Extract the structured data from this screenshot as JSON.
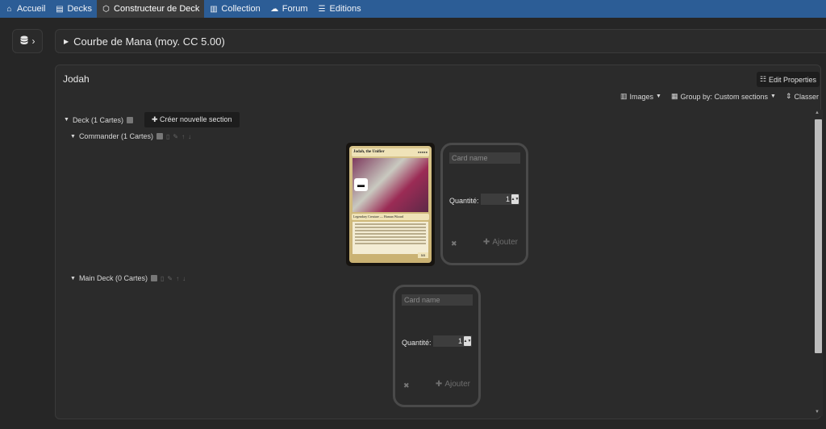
{
  "nav": {
    "items": [
      {
        "label": "Accueil",
        "icon": "home-icon",
        "glyph": "⌂"
      },
      {
        "label": "Decks",
        "icon": "decks-icon",
        "glyph": "▤"
      },
      {
        "label": "Constructeur de Deck",
        "icon": "deck-builder-icon",
        "glyph": "⬡",
        "active": true
      },
      {
        "label": "Collection",
        "icon": "collection-icon",
        "glyph": "▥"
      },
      {
        "label": "Forum",
        "icon": "forum-icon",
        "glyph": "☁"
      },
      {
        "label": "Editions",
        "icon": "editions-icon",
        "glyph": "☰"
      }
    ]
  },
  "mana_curve": {
    "label": "Courbe de Mana (moy. CC 5.00)"
  },
  "deck": {
    "title": "Jodah",
    "edit_label": "Edit Properties",
    "toolbar": {
      "images_label": "Images",
      "group_label": "Group by: Custom sections",
      "sort_label": "Classer"
    },
    "root_section": {
      "label": "Deck (1 Cartes)",
      "new_section_label": "Créer nouvelle section"
    },
    "commander_section": {
      "label": "Commander (1 Cartes)"
    },
    "main_section": {
      "label": "Main Deck (0 Cartes)"
    },
    "card": {
      "name": "Jodah, the Unifier",
      "type": "Legendary Creature — Human Wizard",
      "pt": "5/5"
    },
    "add_form": {
      "placeholder": "Card name",
      "qty_label": "Quantité:",
      "qty_value": "1",
      "add_label": "Ajouter"
    }
  }
}
